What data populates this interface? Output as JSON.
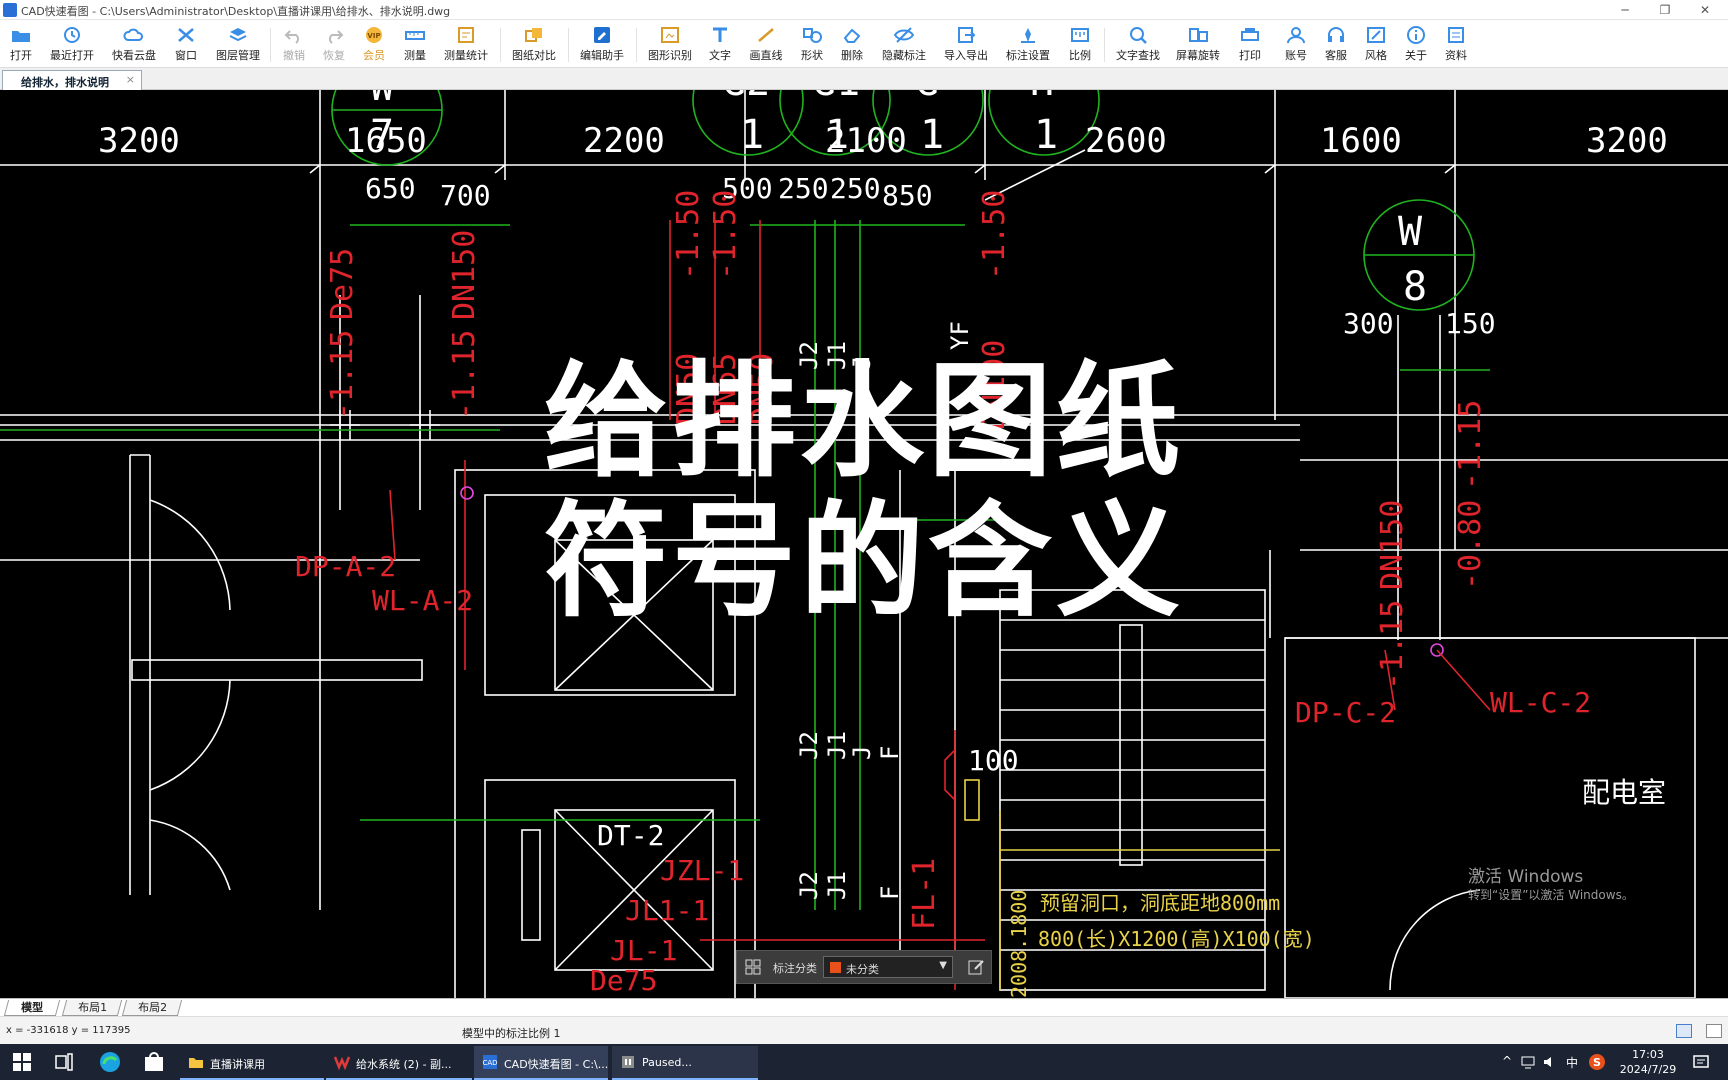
{
  "window": {
    "title": "CAD快速看图 - C:\\Users\\Administrator\\Desktop\\直播讲课用\\给排水、排水说明.dwg",
    "minimize": "─",
    "restore": "❐",
    "close": "✕"
  },
  "toolbar": {
    "items": [
      {
        "label": "打开",
        "icon": "folder-open-icon"
      },
      {
        "label": "最近打开",
        "icon": "recent-icon"
      },
      {
        "label": "快看云盘",
        "icon": "cloud-icon"
      },
      {
        "label": "窗口",
        "icon": "window-icon"
      },
      {
        "label": "图层管理",
        "icon": "layers-icon"
      },
      {
        "label": "撤销",
        "icon": "undo-icon"
      },
      {
        "label": "恢复",
        "icon": "redo-icon"
      },
      {
        "label": "会员",
        "icon": "vip-icon"
      },
      {
        "label": "测量",
        "icon": "measure-icon"
      },
      {
        "label": "测量统计",
        "icon": "measure-stats-icon"
      },
      {
        "label": "图纸对比",
        "icon": "compare-icon"
      },
      {
        "label": "编辑助手",
        "icon": "edit-assistant-icon"
      },
      {
        "label": "图形识别",
        "icon": "recognize-icon"
      },
      {
        "label": "文字",
        "icon": "text-icon"
      },
      {
        "label": "画直线",
        "icon": "line-icon"
      },
      {
        "label": "形状",
        "icon": "shape-icon"
      },
      {
        "label": "删除",
        "icon": "eraser-icon"
      },
      {
        "label": "隐藏标注",
        "icon": "hide-annotation-icon"
      },
      {
        "label": "导入导出",
        "icon": "import-export-icon"
      },
      {
        "label": "标注设置",
        "icon": "annotation-settings-icon"
      },
      {
        "label": "比例",
        "icon": "scale-icon"
      },
      {
        "label": "文字查找",
        "icon": "text-search-icon"
      },
      {
        "label": "屏幕旋转",
        "icon": "rotate-screen-icon"
      },
      {
        "label": "打印",
        "icon": "printer-icon"
      },
      {
        "label": "账号",
        "icon": "account-icon"
      },
      {
        "label": "客服",
        "icon": "headset-icon"
      },
      {
        "label": "风格",
        "icon": "style-icon"
      },
      {
        "label": "关于",
        "icon": "info-icon"
      },
      {
        "label": "资料",
        "icon": "docs-icon"
      }
    ]
  },
  "doc_tab": {
    "label": "给排水，排水说明",
    "close": "×"
  },
  "drawing": {
    "dimensions_top": [
      "3200",
      "1650",
      "2200",
      "2100",
      "2600",
      "1600",
      "3200"
    ],
    "dimensions_second": [
      "650",
      "700",
      "500",
      "250",
      "250",
      "850"
    ],
    "axis_labels": [
      "W",
      "7",
      "G2",
      "1",
      "G1",
      "1",
      "G",
      "1",
      "H",
      "1"
    ],
    "axis_w8": {
      "top": "W",
      "bottom": "8"
    },
    "dim_300": "300",
    "dim_150": "150",
    "red_labels": [
      "De75",
      "DN150",
      "-1.15",
      "-1.15",
      "DN50",
      "DN65",
      "DN50",
      "-1.50",
      "-1.50",
      "DP-A-2",
      "WL-A-2",
      "DP-C-2",
      "WL-C-2",
      "De75",
      "DN150",
      "-1.15",
      "-1.15",
      "-0.80",
      "FL-1",
      "JZL-1",
      "JL1-1",
      "JL-1",
      "DN100",
      "-1.50"
    ],
    "white_labels": [
      "J2",
      "J1",
      "J",
      "J2",
      "J1",
      "J",
      "J2",
      "J1",
      "F",
      "F",
      "YF",
      "DT-2",
      "100",
      "配电室"
    ],
    "yellow_labels": [
      "预留洞口，洞底距地800mm",
      "800(长)X1200(高)X100(宽)",
      "2008.1800"
    ]
  },
  "overlay": {
    "line1": "给排水图纸",
    "line2": "符号的含义"
  },
  "anno_bar": {
    "label": "标注分类",
    "value": "未分类",
    "arrow": "▼"
  },
  "watermark": {
    "line1": "激活 Windows",
    "line2": "转到“设置”以激活 Windows。"
  },
  "layout_tabs": [
    "模型",
    "布局1",
    "布局2"
  ],
  "status": {
    "coords": "x = -331618  y = 117395",
    "scale": "模型中的标注比例 1"
  },
  "taskbar": {
    "apps": [
      {
        "label": "直播讲课用",
        "icon": "folder-icon"
      },
      {
        "label": "给水系统 (2) - 副...",
        "icon": "wps-icon"
      },
      {
        "label": "CAD快速看图 - C:\\...",
        "icon": "cad-icon"
      },
      {
        "label": "Paused...",
        "icon": "recorder-icon"
      }
    ],
    "tray": {
      "ime": "中",
      "time": "17:03",
      "date": "2024/7/29"
    }
  },
  "colors": {
    "accent": "#2a6fd6",
    "cad_red": "#e0242c",
    "cad_green": "#1fb41f",
    "cad_yellow": "#e8d24a",
    "cad_white": "#ffffff"
  }
}
